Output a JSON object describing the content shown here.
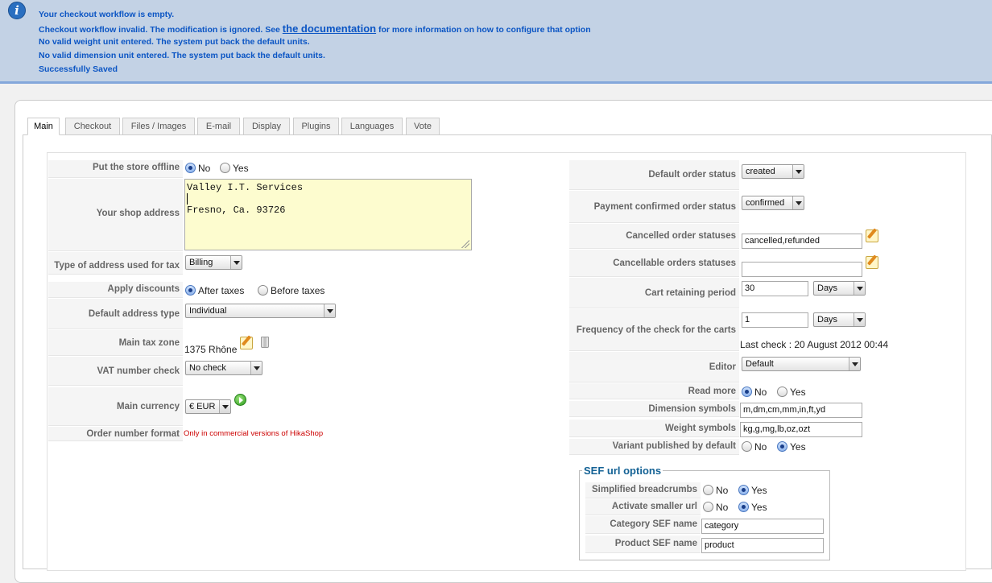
{
  "messages": {
    "icon": "info-icon",
    "line1": "Your checkout workflow is empty.",
    "line2_before": "Checkout workflow invalid. The modification is ignored. See ",
    "line2_link": "the documentation",
    "line2_after": " for more information on how to configure that option",
    "line3": "No valid weight unit entered. The system put back the default units.",
    "line4": "No valid dimension unit entered. The system put back the default units.",
    "line5": "Successfully Saved"
  },
  "tabs": [
    "Main",
    "Checkout",
    "Files / Images",
    "E-mail",
    "Display",
    "Plugins",
    "Languages",
    "Vote"
  ],
  "left": {
    "store_offline": {
      "label": "Put the store offline",
      "opt_no": "No",
      "opt_yes": "Yes",
      "selected": "No"
    },
    "shop_address": {
      "label": "Your shop address",
      "line1": "Valley I.T. Services",
      "line2": "",
      "line3": "Fresno, Ca. 93726"
    },
    "address_tax": {
      "label": "Type of address used for tax",
      "value": "Billing"
    },
    "apply_discounts": {
      "label": "Apply discounts",
      "opt_after": "After taxes",
      "opt_before": "Before taxes",
      "selected": "After taxes"
    },
    "default_address": {
      "label": "Default address type",
      "value": "Individual"
    },
    "main_tax_zone": {
      "label": "Main tax zone",
      "value": "1375 Rhône"
    },
    "vat_check": {
      "label": "VAT number check",
      "value": "No check"
    },
    "main_currency": {
      "label": "Main currency",
      "value": "€ EUR"
    },
    "order_number": {
      "label": "Order number format",
      "note": "Only in commercial versions of HikaShop"
    }
  },
  "right": {
    "default_order_status": {
      "label": "Default order status",
      "value": "created"
    },
    "payment_confirmed": {
      "label": "Payment confirmed order status",
      "value": "confirmed"
    },
    "cancelled_statuses": {
      "label": "Cancelled order statuses",
      "value": "cancelled,refunded"
    },
    "cancellable_statuses": {
      "label": "Cancellable orders statuses",
      "value": ""
    },
    "cart_retaining": {
      "label": "Cart retaining period",
      "value": "30",
      "unit": "Days"
    },
    "check_frequency": {
      "label": "Frequency of the check for the carts",
      "value": "1",
      "unit": "Days",
      "last_check": "Last check : 20 August 2012 00:44"
    },
    "editor": {
      "label": "Editor",
      "value": "Default"
    },
    "read_more": {
      "label": "Read more",
      "opt_no": "No",
      "opt_yes": "Yes",
      "selected": "No"
    },
    "dimension_symbols": {
      "label": "Dimension symbols",
      "value": "m,dm,cm,mm,in,ft,yd"
    },
    "weight_symbols": {
      "label": "Weight symbols",
      "value": "kg,g,mg,lb,oz,ozt"
    },
    "variant_published": {
      "label": "Variant published by default",
      "opt_no": "No",
      "opt_yes": "Yes",
      "selected": "Yes"
    }
  },
  "sef": {
    "legend": "SEF url options",
    "breadcrumbs": {
      "label": "Simplified breadcrumbs",
      "opt_no": "No",
      "opt_yes": "Yes",
      "selected": "Yes"
    },
    "smaller_url": {
      "label": "Activate smaller url",
      "opt_no": "No",
      "opt_yes": "Yes",
      "selected": "Yes"
    },
    "category_name": {
      "label": "Category SEF name",
      "value": "category"
    },
    "product_name": {
      "label": "Product SEF name",
      "value": "product"
    }
  }
}
